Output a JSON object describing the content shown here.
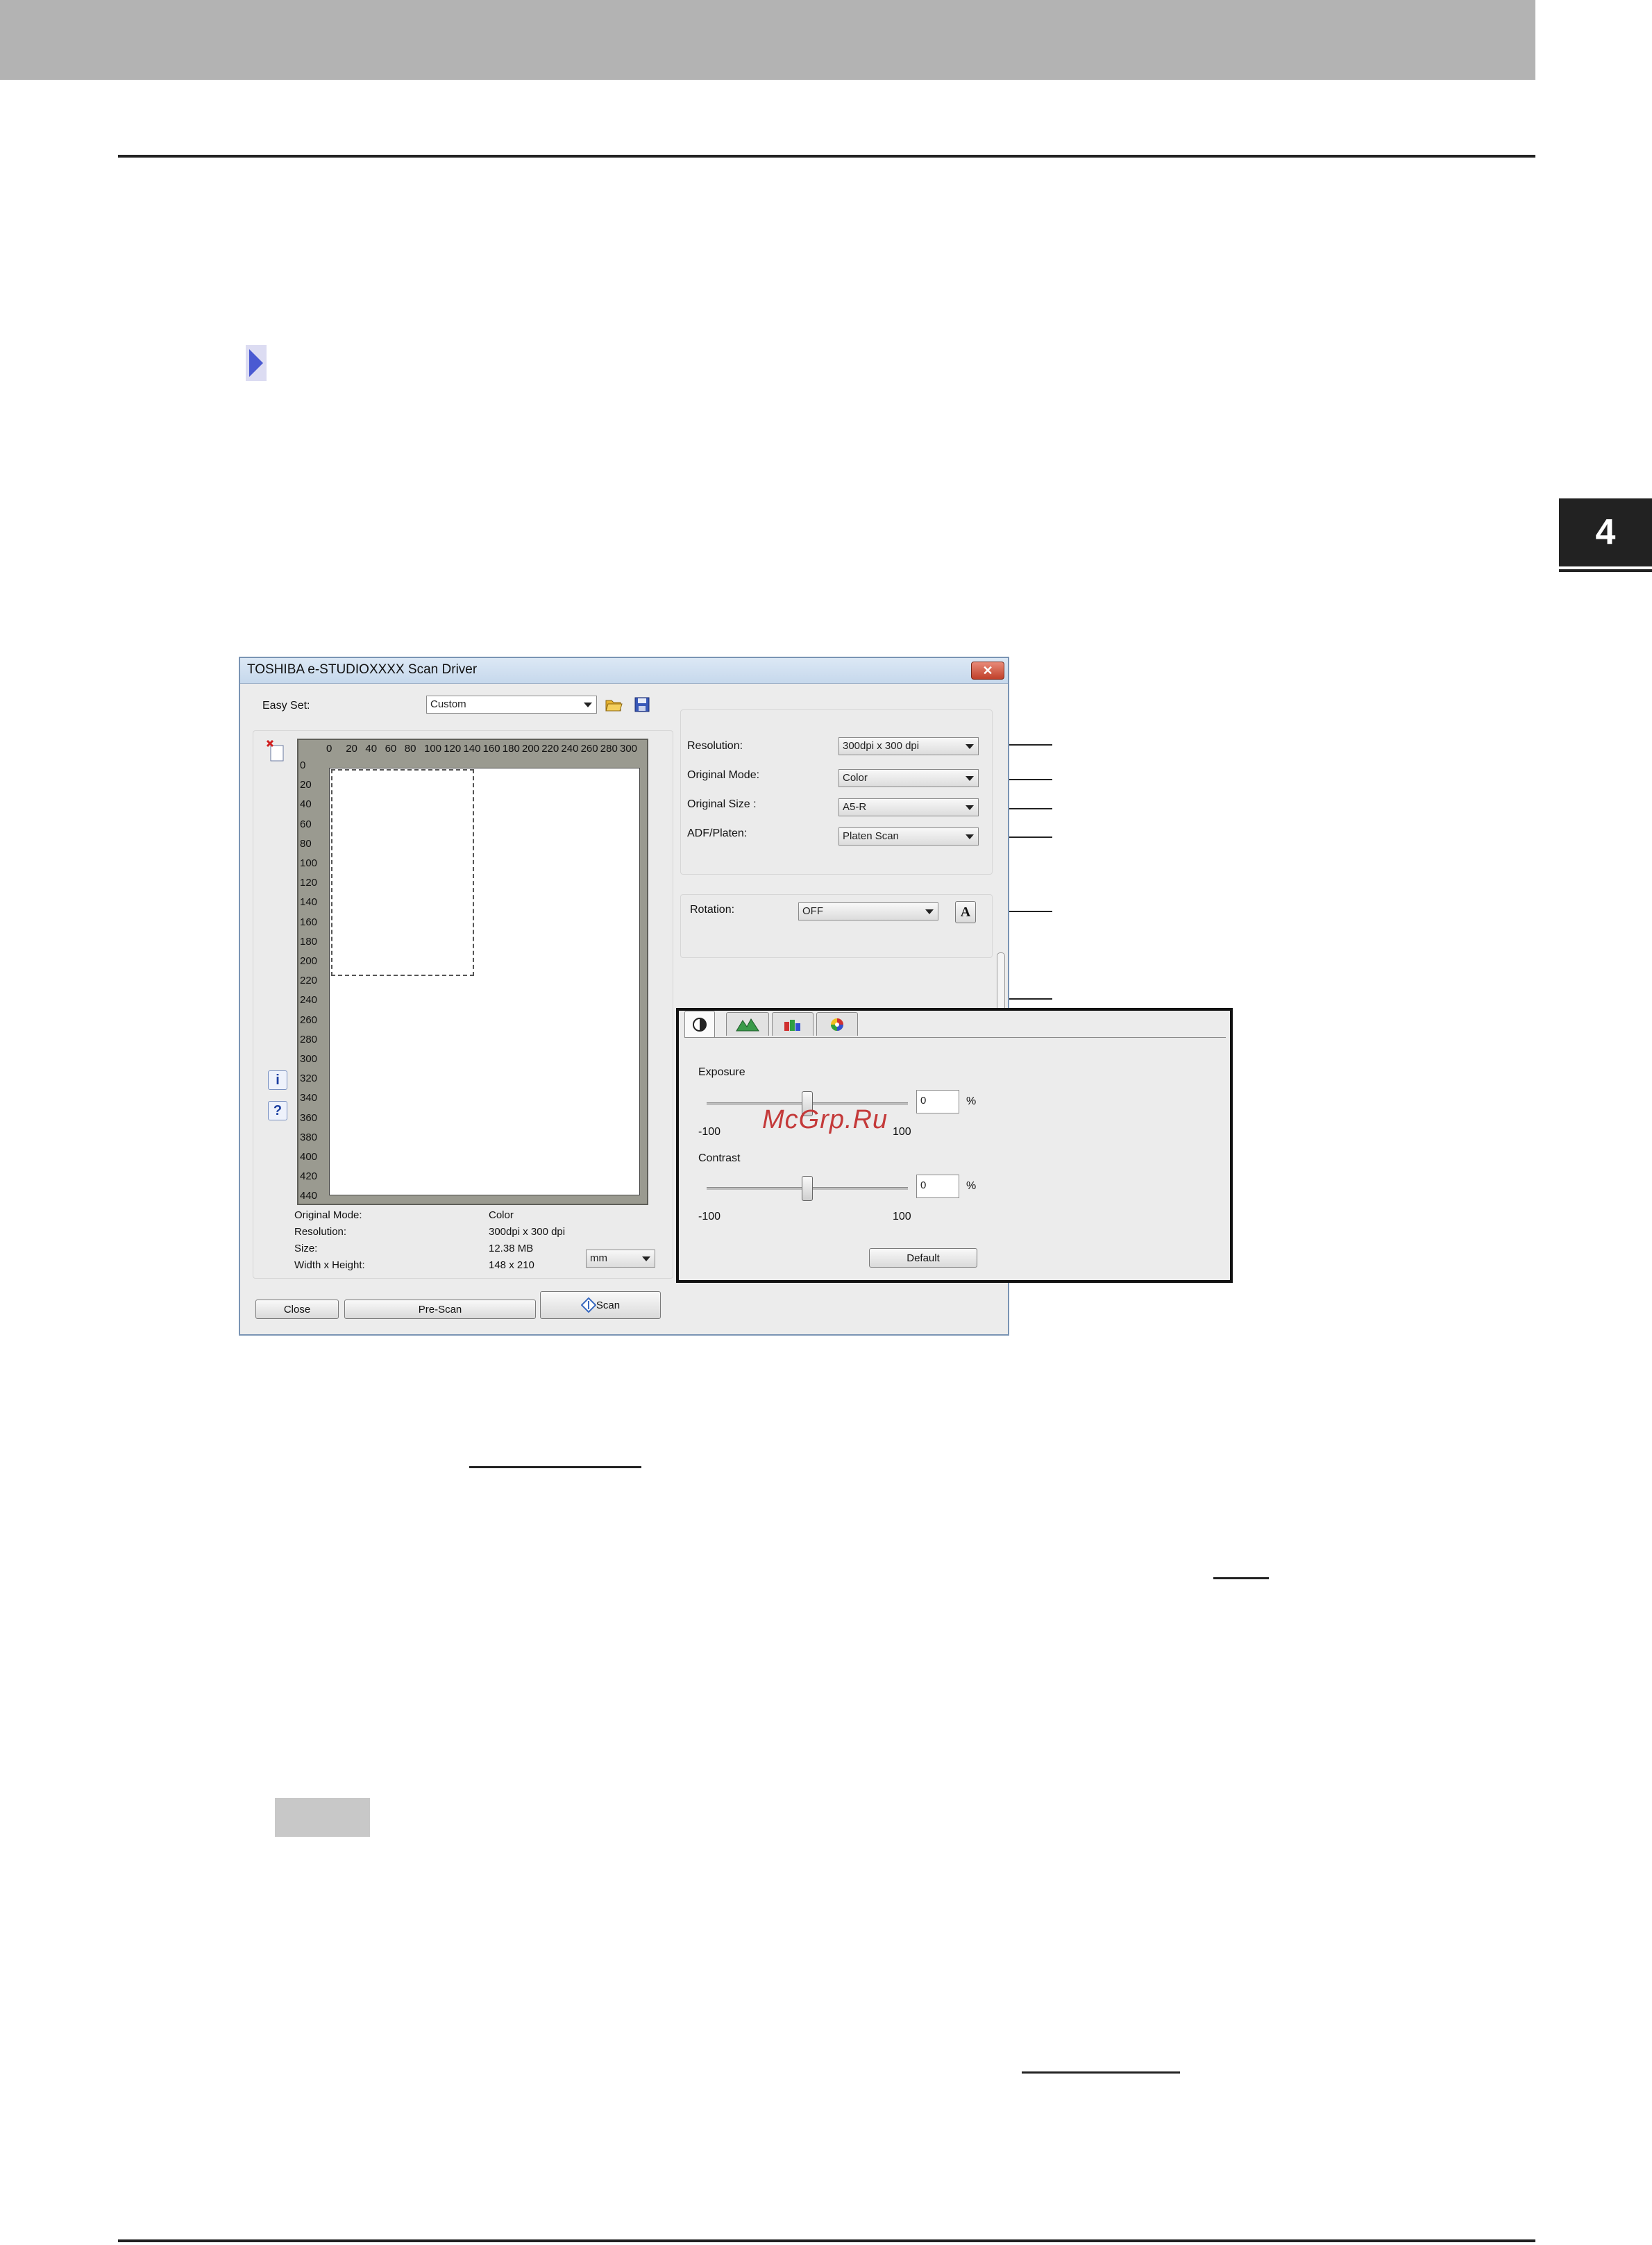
{
  "page": {
    "chapter_number": "4",
    "watermark": "McGrp.Ru"
  },
  "dialog": {
    "title": "TOSHIBA e-STUDIOXXXX Scan Driver",
    "close_glyph": "✕",
    "easy_set": {
      "label": "Easy Set:",
      "value": "Custom"
    },
    "preview": {
      "ruler_x": [
        "0",
        "20",
        "40",
        "60",
        "80",
        "100",
        "120",
        "140",
        "160",
        "180",
        "200",
        "220",
        "240",
        "260",
        "280",
        "300"
      ],
      "ruler_y": [
        "0",
        "20",
        "40",
        "60",
        "80",
        "100",
        "120",
        "140",
        "160",
        "180",
        "200",
        "220",
        "240",
        "260",
        "280",
        "300",
        "320",
        "340",
        "360",
        "380",
        "400",
        "420",
        "440"
      ]
    },
    "info": {
      "original_mode_label": "Original Mode:",
      "original_mode_value": "Color",
      "resolution_label": "Resolution:",
      "resolution_value": "300dpi x 300 dpi",
      "size_label": "Size:",
      "size_value": "12.38 MB",
      "wh_label": "Width x Height:",
      "wh_value": "148 x 210",
      "unit": "mm"
    },
    "settings": {
      "resolution": {
        "label": "Resolution:",
        "value": "300dpi x 300 dpi"
      },
      "original_mode": {
        "label": "Original Mode:",
        "value": "Color"
      },
      "original_size": {
        "label": "Original Size :",
        "value": "A5-R"
      },
      "adf_platen": {
        "label": "ADF/Platen:",
        "value": "Platen Scan"
      },
      "rotation": {
        "label": "Rotation:",
        "value": "OFF"
      },
      "rotation_icon_letter": "A"
    },
    "adjust": {
      "exposure": {
        "label": "Exposure",
        "value": "0",
        "unit": "%",
        "min": "-100",
        "max": "100",
        "level": 0
      },
      "contrast": {
        "label": "Contrast",
        "value": "0",
        "unit": "%",
        "min": "-100",
        "max": "100",
        "level": 0
      },
      "default_button": "Default"
    },
    "buttons": {
      "close": "Close",
      "prescan": "Pre-Scan",
      "scan": "Scan"
    },
    "side_icons": {
      "info": "i",
      "help": "?"
    }
  }
}
